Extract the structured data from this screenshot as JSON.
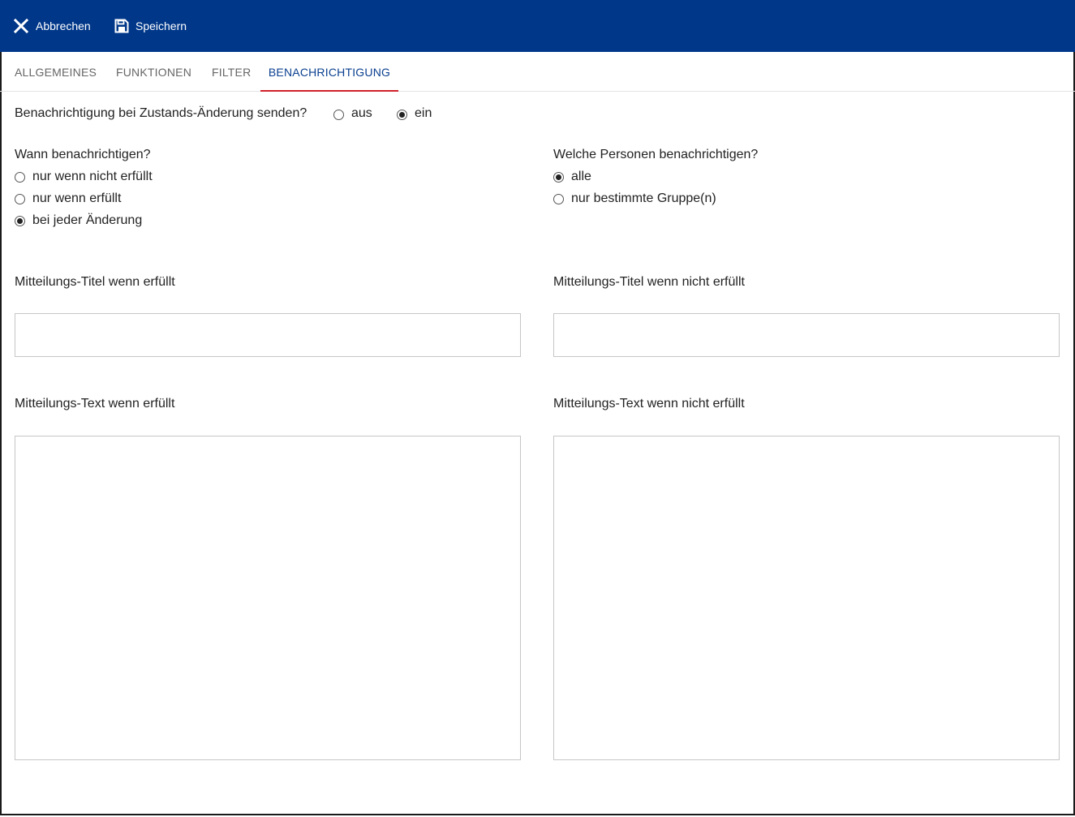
{
  "toolbar": {
    "cancel_label": "Abbrechen",
    "save_label": "Speichern",
    "cancel_icon": "close-icon",
    "save_icon": "floppy-disk-icon",
    "background": "#003789"
  },
  "tabs": [
    {
      "label": "ALLGEMEINES",
      "active": false
    },
    {
      "label": "FUNKTIONEN",
      "active": false
    },
    {
      "label": "FILTER",
      "active": false
    },
    {
      "label": "BENACHRICHTIGUNG",
      "active": true
    }
  ],
  "notify": {
    "question": "Benachrichtigung bei Zustands-Änderung senden?",
    "options": [
      {
        "label": "aus",
        "selected": false
      },
      {
        "label": "ein",
        "selected": true
      }
    ]
  },
  "when": {
    "question": "Wann benachrichtigen?",
    "options": [
      {
        "label": "nur wenn nicht erfüllt",
        "selected": false
      },
      {
        "label": "nur wenn erfüllt",
        "selected": false
      },
      {
        "label": "bei jeder Änderung",
        "selected": true
      }
    ]
  },
  "who": {
    "question": "Welche Personen benachrichtigen?",
    "options": [
      {
        "label": "alle",
        "selected": true
      },
      {
        "label": "nur bestimmte Gruppe(n)",
        "selected": false
      }
    ]
  },
  "messages": {
    "title_fulfilled_label": "Mitteilungs-Titel wenn erfüllt",
    "title_fulfilled_value": "",
    "title_not_fulfilled_label": "Mitteilungs-Titel wenn nicht erfüllt",
    "title_not_fulfilled_value": "",
    "text_fulfilled_label": "Mitteilungs-Text wenn erfüllt",
    "text_fulfilled_value": "",
    "text_not_fulfilled_label": "Mitteilungs-Text wenn nicht erfüllt",
    "text_not_fulfilled_value": ""
  }
}
